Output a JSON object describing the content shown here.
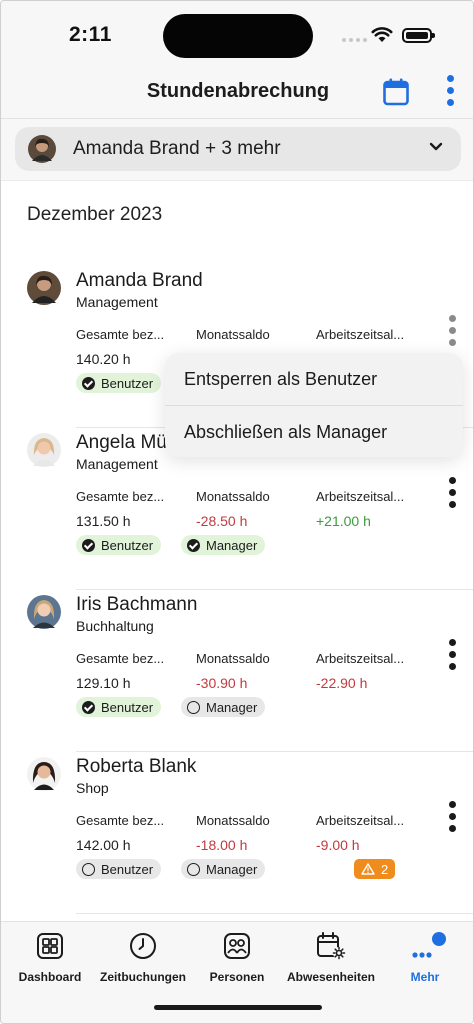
{
  "status": {
    "time": "2:11"
  },
  "header": {
    "title": "Stundenabrechung"
  },
  "filter": {
    "label": "Amanda Brand + 3 mehr"
  },
  "month": "Dezember 2023",
  "columns": {
    "col1": "Gesamte bez...",
    "col2": "Monatssaldo",
    "col3": "Arbeitszeitsal..."
  },
  "employees": [
    {
      "name": "Amanda Brand",
      "dept": "Management",
      "total": "140.20 h",
      "monthly": "",
      "balance": "",
      "badge_user": "Benutzer",
      "badge_manager": ""
    },
    {
      "name": "Angela Mü",
      "dept": "Management",
      "total": "131.50 h",
      "monthly": "-28.50 h",
      "balance": "+21.00 h",
      "badge_user": "Benutzer",
      "badge_manager": "Manager"
    },
    {
      "name": "Iris Bachmann",
      "dept": "Buchhaltung",
      "total": "129.10 h",
      "monthly": "-30.90 h",
      "balance": "-22.90 h",
      "badge_user": "Benutzer",
      "badge_manager": "Manager"
    },
    {
      "name": "Roberta Blank",
      "dept": "Shop",
      "total": "142.00 h",
      "monthly": "-18.00 h",
      "balance": "-9.00 h",
      "badge_user": "Benutzer",
      "badge_manager": "Manager",
      "warning_count": "2"
    }
  ],
  "popup": {
    "unlock_user": "Entsperren als Benutzer",
    "lock_manager": "Abschließen als Manager"
  },
  "tabs": [
    {
      "label": "Dashboard",
      "icon": "dashboard-icon"
    },
    {
      "label": "Zeitbuchungen",
      "icon": "clock-icon"
    },
    {
      "label": "Personen",
      "icon": "people-icon"
    },
    {
      "label": "Abwesenheiten",
      "icon": "calendar-sun-icon"
    },
    {
      "label": "Mehr",
      "icon": "more-dots-icon"
    }
  ],
  "colors": {
    "accent": "#1f6fe0",
    "negative": "#c23a3f",
    "positive": "#3a9d3a",
    "warning": "#f08c1e"
  }
}
